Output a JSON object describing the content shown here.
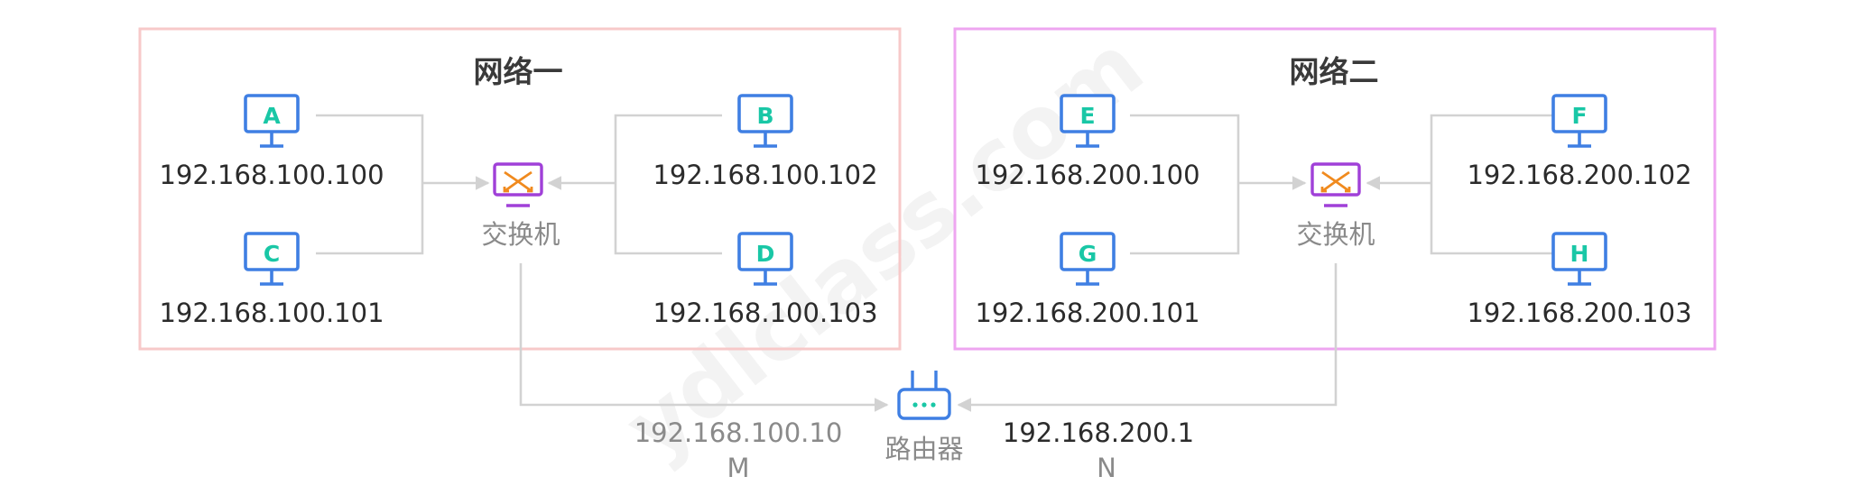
{
  "networks": [
    {
      "title": "网络一",
      "color": "#f7c9c9",
      "switch_label": "交换机",
      "hosts": [
        {
          "letter": "A",
          "ip": "192.168.100.100"
        },
        {
          "letter": "C",
          "ip": "192.168.100.101"
        },
        {
          "letter": "B",
          "ip": "192.168.100.102"
        },
        {
          "letter": "D",
          "ip": "192.168.100.103"
        }
      ]
    },
    {
      "title": "网络二",
      "color": "#eea6f0",
      "switch_label": "交换机",
      "hosts": [
        {
          "letter": "E",
          "ip": "192.168.200.100"
        },
        {
          "letter": "G",
          "ip": "192.168.200.101"
        },
        {
          "letter": "F",
          "ip": "192.168.200.102"
        },
        {
          "letter": "H",
          "ip": "192.168.200.103"
        }
      ]
    }
  ],
  "router": {
    "label": "路由器",
    "port_m": {
      "ip": "192.168.100.10",
      "name": "M"
    },
    "port_n": {
      "ip": "192.168.200.1",
      "name": "N"
    }
  },
  "watermark": "ydlclass.com",
  "colors": {
    "monitor": "#3f7fe3",
    "letter": "#19c7a6",
    "switch_frame": "#a040d8",
    "switch_arrows": "#f08a1e",
    "wire": "#d2d2d2"
  },
  "icons": [
    "monitor-icon",
    "switch-icon",
    "router-icon"
  ]
}
